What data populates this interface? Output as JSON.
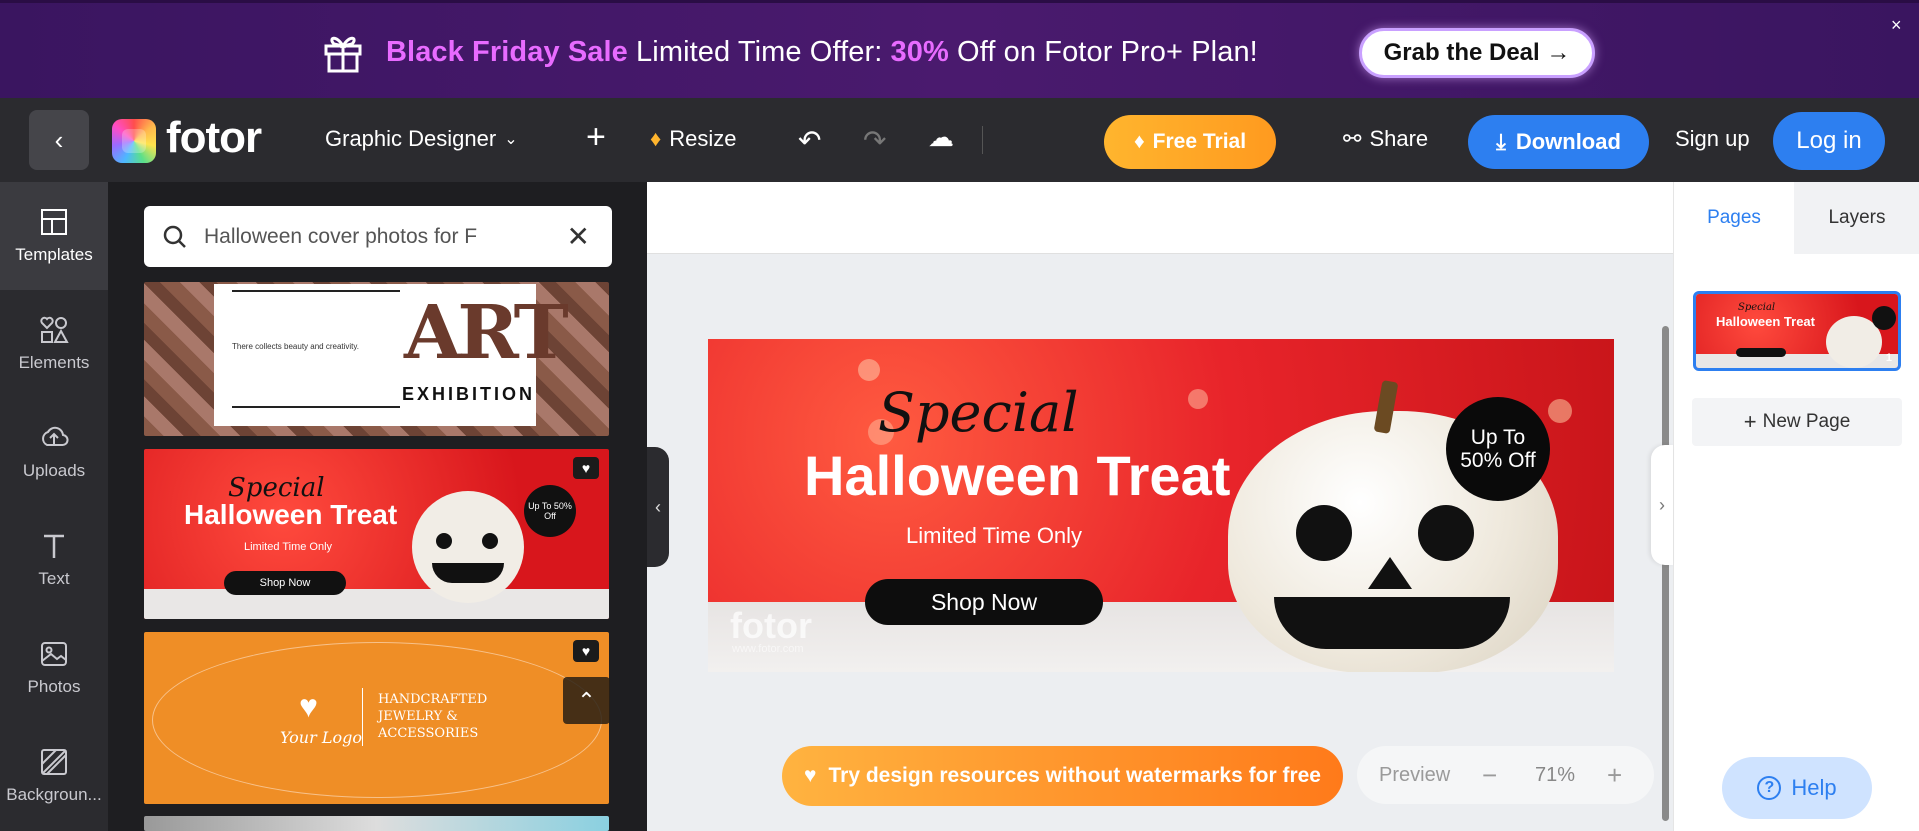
{
  "banner": {
    "sale": "Black Friday Sale",
    "text1": " Limited Time Offer: ",
    "percent": "30%",
    "text2": " Off on Fotor Pro+ Plan!",
    "cta": "Grab the Deal →",
    "close": "×"
  },
  "topbar": {
    "logo": "fotor",
    "mode": "Graphic Designer",
    "resize": "Resize",
    "free_trial": "Free Trial",
    "share": "Share",
    "download": "Download",
    "signup": "Sign up",
    "login": "Log in"
  },
  "sidebar": {
    "items": [
      {
        "label": "Templates",
        "icon": "templates-icon"
      },
      {
        "label": "Elements",
        "icon": "elements-icon"
      },
      {
        "label": "Uploads",
        "icon": "uploads-icon"
      },
      {
        "label": "Text",
        "icon": "text-icon"
      },
      {
        "label": "Photos",
        "icon": "photos-icon"
      },
      {
        "label": "Backgroun...",
        "icon": "background-icon"
      }
    ]
  },
  "panel": {
    "search_value": "Halloween cover photos for F",
    "thumb1": {
      "small": "There collects beauty and creativity.",
      "big": "ART",
      "sub": "EXHIBITION"
    },
    "thumb2": {
      "script": "Special",
      "title": "Halloween Treat",
      "sub": "Limited Time Only",
      "btn": "Shop Now",
      "badge": "Up To 50% Off"
    },
    "thumb3": {
      "logo": "Your Logo",
      "text": "HANDCRAFTED JEWELRY & ACCESSORIES"
    }
  },
  "design": {
    "script": "Special",
    "title": "Halloween Treat",
    "sub": "Limited Time Only",
    "btn": "Shop Now",
    "badge1": "Up To",
    "badge2": "50% Off",
    "watermark": "fotor",
    "watermark_url": "www.fotor.com"
  },
  "canvas": {
    "promo": "Try design resources without watermarks for free",
    "preview": "Preview",
    "zoom": "71%"
  },
  "right": {
    "tab_pages": "Pages",
    "tab_layers": "Layers",
    "new_page": "New Page",
    "page_num": "1",
    "help": "Help"
  },
  "colors": {
    "accent": "#2d7ff0",
    "banner": "#3a1560",
    "design_red": "#e8242a",
    "orange": "#ff9a1f"
  }
}
